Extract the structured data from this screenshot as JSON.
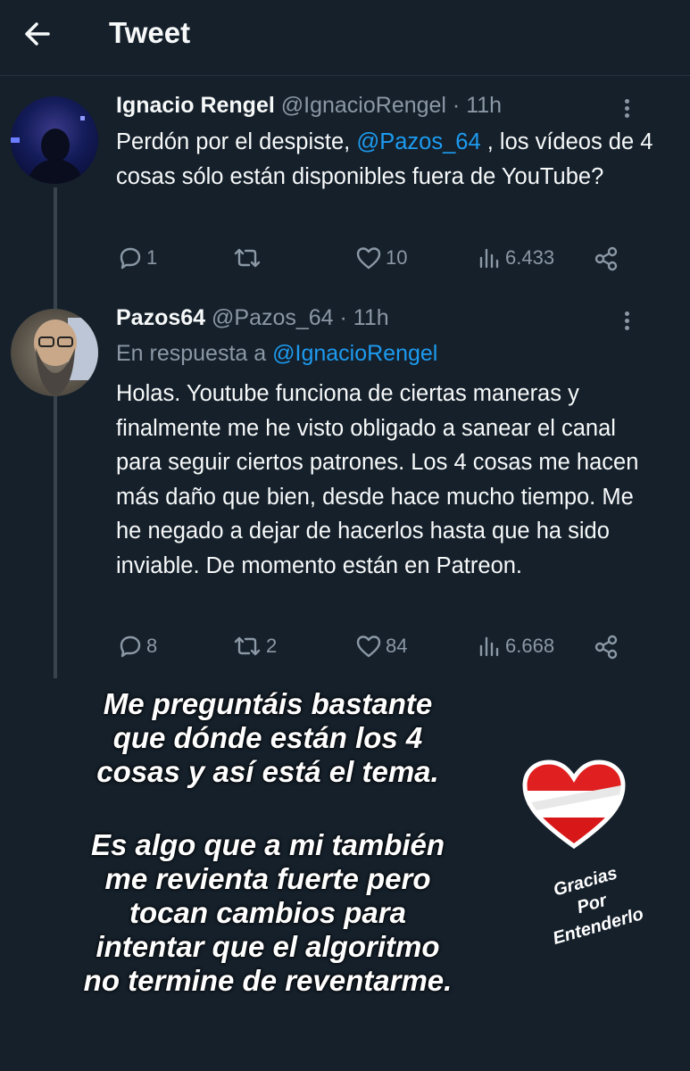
{
  "header": {
    "title": "Tweet"
  },
  "tweets": [
    {
      "name": "Ignacio Rengel",
      "handle": "@IgnacioRengel",
      "time": " · 11h",
      "text_before": "Perdón por el despiste, ",
      "mention": "@Pazos_64",
      "text_after": " , los vídeos de 4 cosas sólo están disponibles fuera de YouTube?",
      "replies": "1",
      "retweets": "",
      "likes": "10",
      "views": "6.433"
    },
    {
      "name": "Pazos64",
      "handle": "@Pazos_64",
      "time": " · 11h",
      "reply_prefix": "En respuesta a ",
      "reply_to": "@IgnacioRengel",
      "text": "Holas. Youtube funciona de ciertas maneras y finalmente me he visto obligado a sanear el canal para seguir ciertos patrones. Los 4 cosas me hacen más daño que bien, desde hace mucho tiempo. Me he negado a dejar de hacerlos hasta que ha sido inviable. De momento están en Patreon.",
      "replies": "8",
      "retweets": "2",
      "likes": "84",
      "views": "6.668"
    }
  ],
  "overlay": {
    "paragraph1": [
      "Me preguntáis bastante",
      "que dónde están los 4",
      "cosas y así está el tema."
    ],
    "paragraph2": [
      "Es algo que a mi también",
      "me revienta fuerte pero",
      "tocan cambios para",
      "intentar que el algoritmo",
      "no termine de reventarme."
    ],
    "thanks": [
      "Gracias",
      "Por",
      "Entenderlo"
    ]
  },
  "icons": {
    "back": "arrow-left-icon",
    "reply": "reply-icon",
    "retweet": "retweet-icon",
    "like": "heart-outline-icon",
    "views": "views-icon",
    "share": "share-icon",
    "more": "more-icon",
    "sticker": "heart-sticker-icon"
  },
  "colors": {
    "background": "#15202b",
    "accent": "#1d9bf0",
    "muted": "#8b98a5"
  }
}
